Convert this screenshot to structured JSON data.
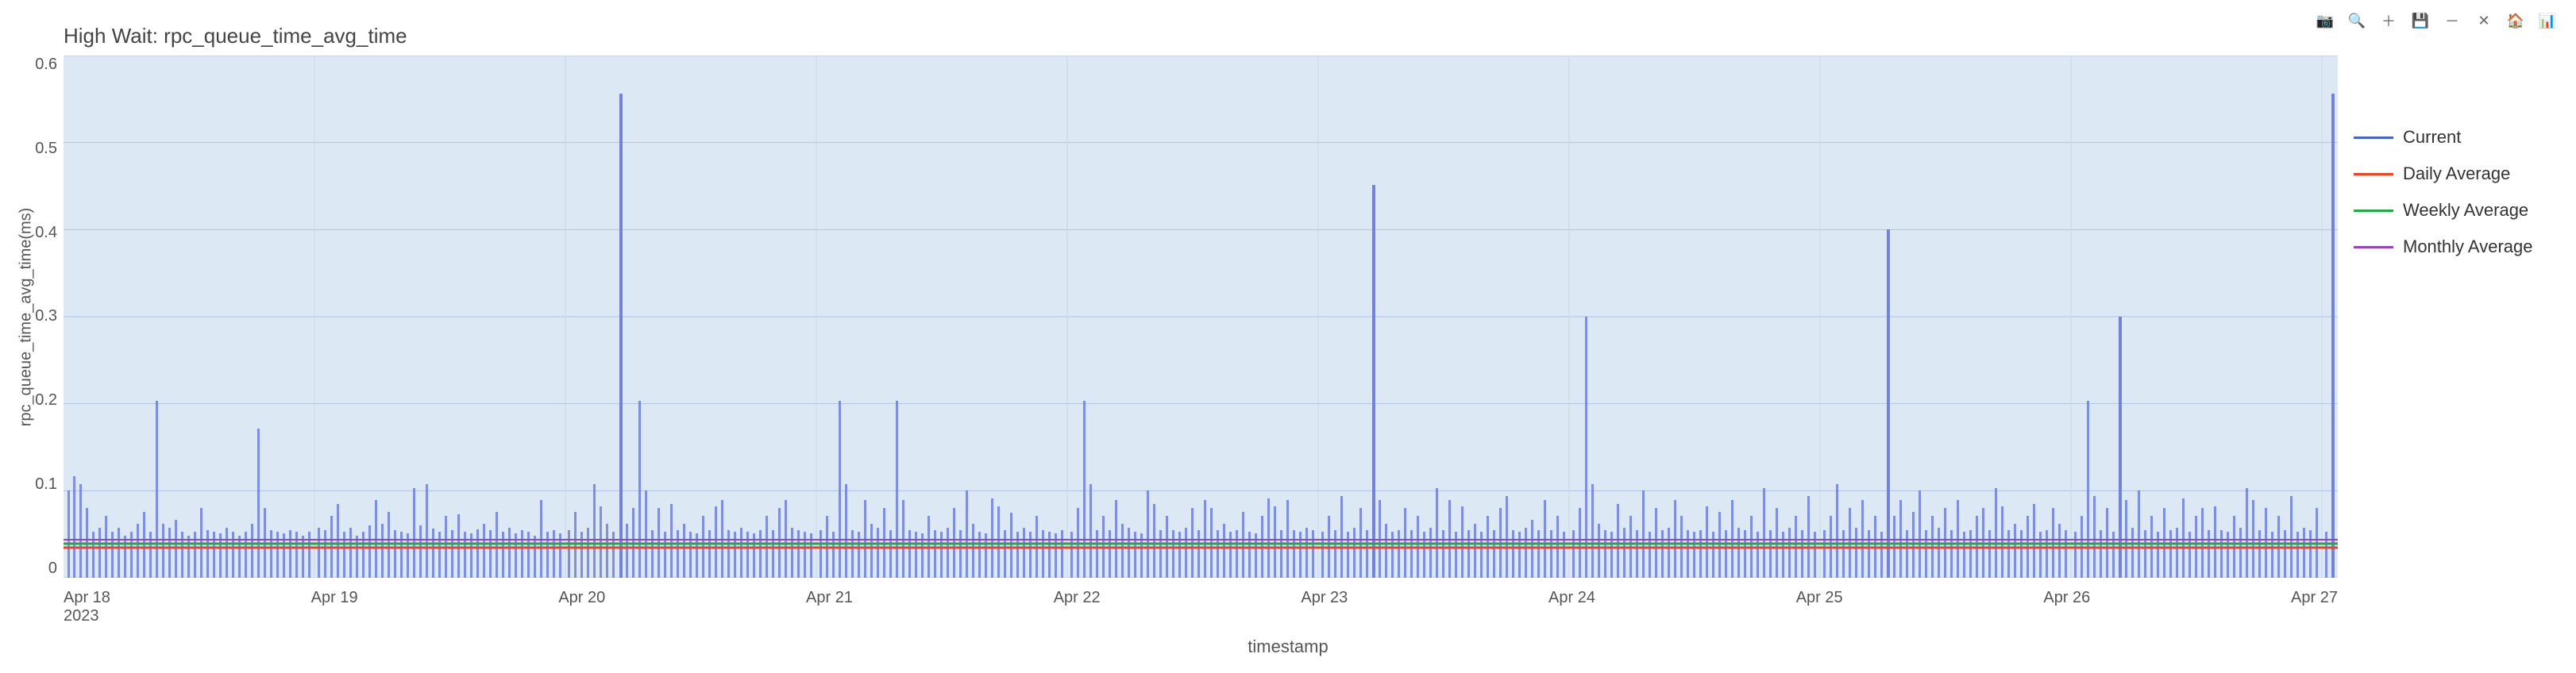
{
  "title": "High Wait: rpc_queue_time_avg_time",
  "yAxisLabel": "rpc_queue_time_avg_time(ms)",
  "xAxisLabel": "timestamp",
  "yTicks": [
    "0.6",
    "0.5",
    "0.4",
    "0.3",
    "0.2",
    "0.1",
    "0"
  ],
  "xTicks": [
    {
      "label": "Apr 18\n2023",
      "sub": "2023"
    },
    {
      "label": "Apr 19"
    },
    {
      "label": "Apr 20"
    },
    {
      "label": "Apr 21"
    },
    {
      "label": "Apr 22"
    },
    {
      "label": "Apr 23"
    },
    {
      "label": "Apr 24"
    },
    {
      "label": "Apr 25"
    },
    {
      "label": "Apr 26"
    },
    {
      "label": "Apr 27"
    }
  ],
  "legend": [
    {
      "label": "Current",
      "color": "#4466cc",
      "type": "line"
    },
    {
      "label": "Daily Average",
      "color": "#ee4422",
      "type": "line"
    },
    {
      "label": "Weekly Average",
      "color": "#22aa44",
      "type": "line"
    },
    {
      "label": "Monthly Average",
      "color": "#9944bb",
      "type": "line"
    }
  ],
  "toolbar": {
    "icons": [
      "camera",
      "zoom",
      "plus",
      "save",
      "minus",
      "arrows",
      "home",
      "bar-chart"
    ]
  },
  "colors": {
    "chartBg": "#dde8f5",
    "gridLine": "#b0c4de",
    "current": "#4466cc",
    "dailyAvg": "#ee4422",
    "weeklyAvg": "#22aa44",
    "monthlyAvg": "#9944bb"
  }
}
